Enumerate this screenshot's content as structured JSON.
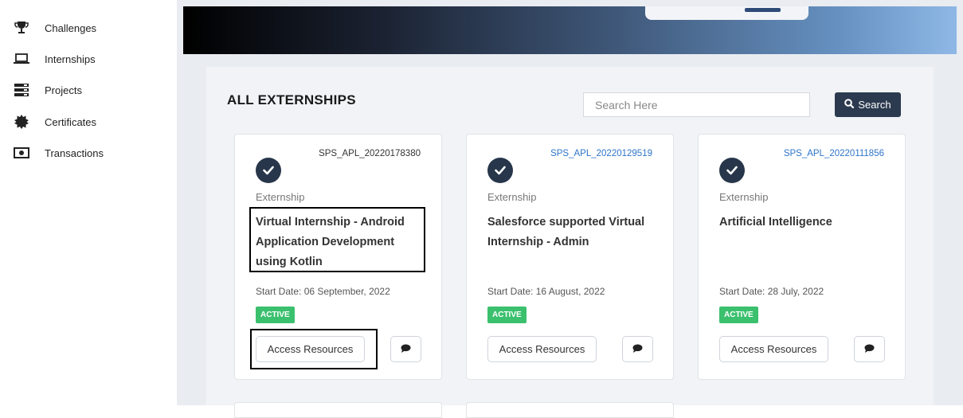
{
  "sidebar": {
    "items": [
      {
        "label": "Challenges",
        "icon": "trophy-icon"
      },
      {
        "label": "Internships",
        "icon": "laptop-icon"
      },
      {
        "label": "Projects",
        "icon": "server-icon"
      },
      {
        "label": "Certificates",
        "icon": "certificate-icon"
      },
      {
        "label": "Transactions",
        "icon": "money-bill-icon"
      }
    ]
  },
  "header": {
    "title": "ALL EXTERNSHIPS"
  },
  "search": {
    "placeholder": "Search Here",
    "button_label": "Search",
    "button_icon": "search-icon"
  },
  "cards": [
    {
      "id": "SPS_APL_20220178380",
      "id_color": "#333333",
      "type": "Externship",
      "title": "Virtual Internship - Android Application Development using Kotlin",
      "start_date": "Start Date: 06 September, 2022",
      "status": "ACTIVE",
      "access_label": "Access Resources",
      "chat_icon": "comment-icon"
    },
    {
      "id": "SPS_APL_20220129519",
      "id_color": "#2e74c9",
      "type": "Externship",
      "title": "Salesforce supported Virtual Internship - Admin",
      "start_date": "Start Date: 16 August, 2022",
      "status": "ACTIVE",
      "access_label": "Access Resources",
      "chat_icon": "comment-icon"
    },
    {
      "id": "SPS_APL_20220111856",
      "id_color": "#2e74c9",
      "type": "Externship",
      "title": "Artificial Intelligence",
      "start_date": "Start Date: 28 July, 2022",
      "status": "ACTIVE",
      "access_label": "Access Resources",
      "chat_icon": "comment-icon"
    }
  ],
  "colors": {
    "status_active": "#3bc06e",
    "search_button": "#2b3a4f",
    "check_circle": "#27364a",
    "link_blue": "#2e74c9"
  }
}
